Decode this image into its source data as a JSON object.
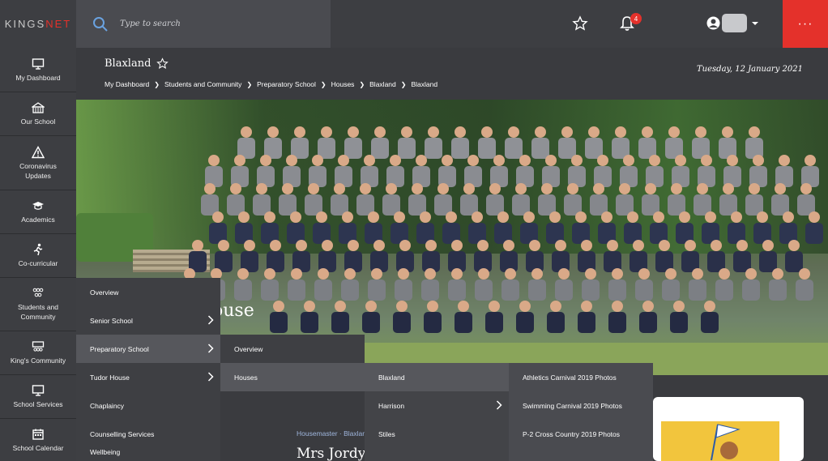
{
  "header": {
    "logo_part1": "KINGS",
    "logo_part2": "NET",
    "search_placeholder": "Type to search",
    "notification_count": "4",
    "more_label": "···"
  },
  "sidebar": {
    "items": [
      {
        "label": "My Dashboard",
        "icon": "monitor-icon"
      },
      {
        "label": "Our School",
        "icon": "school-building-icon"
      },
      {
        "label": "Coronavirus Updates",
        "icon": "warning-icon"
      },
      {
        "label": "Academics",
        "icon": "graduation-cap-icon"
      },
      {
        "label": "Co-curricular",
        "icon": "running-person-icon"
      },
      {
        "label": "Students and Community",
        "icon": "people-group-icon"
      },
      {
        "label": "King's Community",
        "icon": "community-icon"
      },
      {
        "label": "School Services",
        "icon": "monitor-icon"
      },
      {
        "label": "School Calendar",
        "icon": "calendar-icon"
      }
    ]
  },
  "page": {
    "title": "Blaxland",
    "breadcrumbs": [
      "My Dashboard",
      "Students and Community",
      "Preparatory School",
      "Houses",
      "Blaxland",
      "Blaxland"
    ],
    "date": "Tuesday, 12 January 2021"
  },
  "hero": {
    "heading_fragment": "ouse"
  },
  "house": {
    "housemaster_label": "Housemaster · Blaxlan",
    "teacher_name": "Mrs Jordy"
  },
  "menus": {
    "level1": [
      {
        "label": "Overview",
        "has_children": false
      },
      {
        "label": "Senior School",
        "has_children": true
      },
      {
        "label": "Preparatory School",
        "has_children": true,
        "active": true
      },
      {
        "label": "Tudor House",
        "has_children": true
      },
      {
        "label": "Chaplaincy",
        "has_children": false
      },
      {
        "label": "Counselling Services",
        "has_children": false
      },
      {
        "label": "Wellbeing",
        "has_children": false
      }
    ],
    "level2": [
      {
        "label": "Overview",
        "has_children": false
      },
      {
        "label": "Houses",
        "has_children": false,
        "active": true
      }
    ],
    "level3": [
      {
        "label": "Blaxland",
        "has_children": false,
        "active": true
      },
      {
        "label": "Harrison",
        "has_children": true
      },
      {
        "label": "Stiles",
        "has_children": false
      }
    ],
    "level4": [
      {
        "label": "Athletics Carnival 2019 Photos"
      },
      {
        "label": "Swimming Carnival 2019 Photos"
      },
      {
        "label": "P-2 Cross Country 2019 Photos"
      }
    ]
  },
  "colors": {
    "accent": "#e4312b",
    "sidebar_bg": "#3d3e42",
    "menu_active": "#56575c",
    "link_blue": "#9fb6dd"
  }
}
